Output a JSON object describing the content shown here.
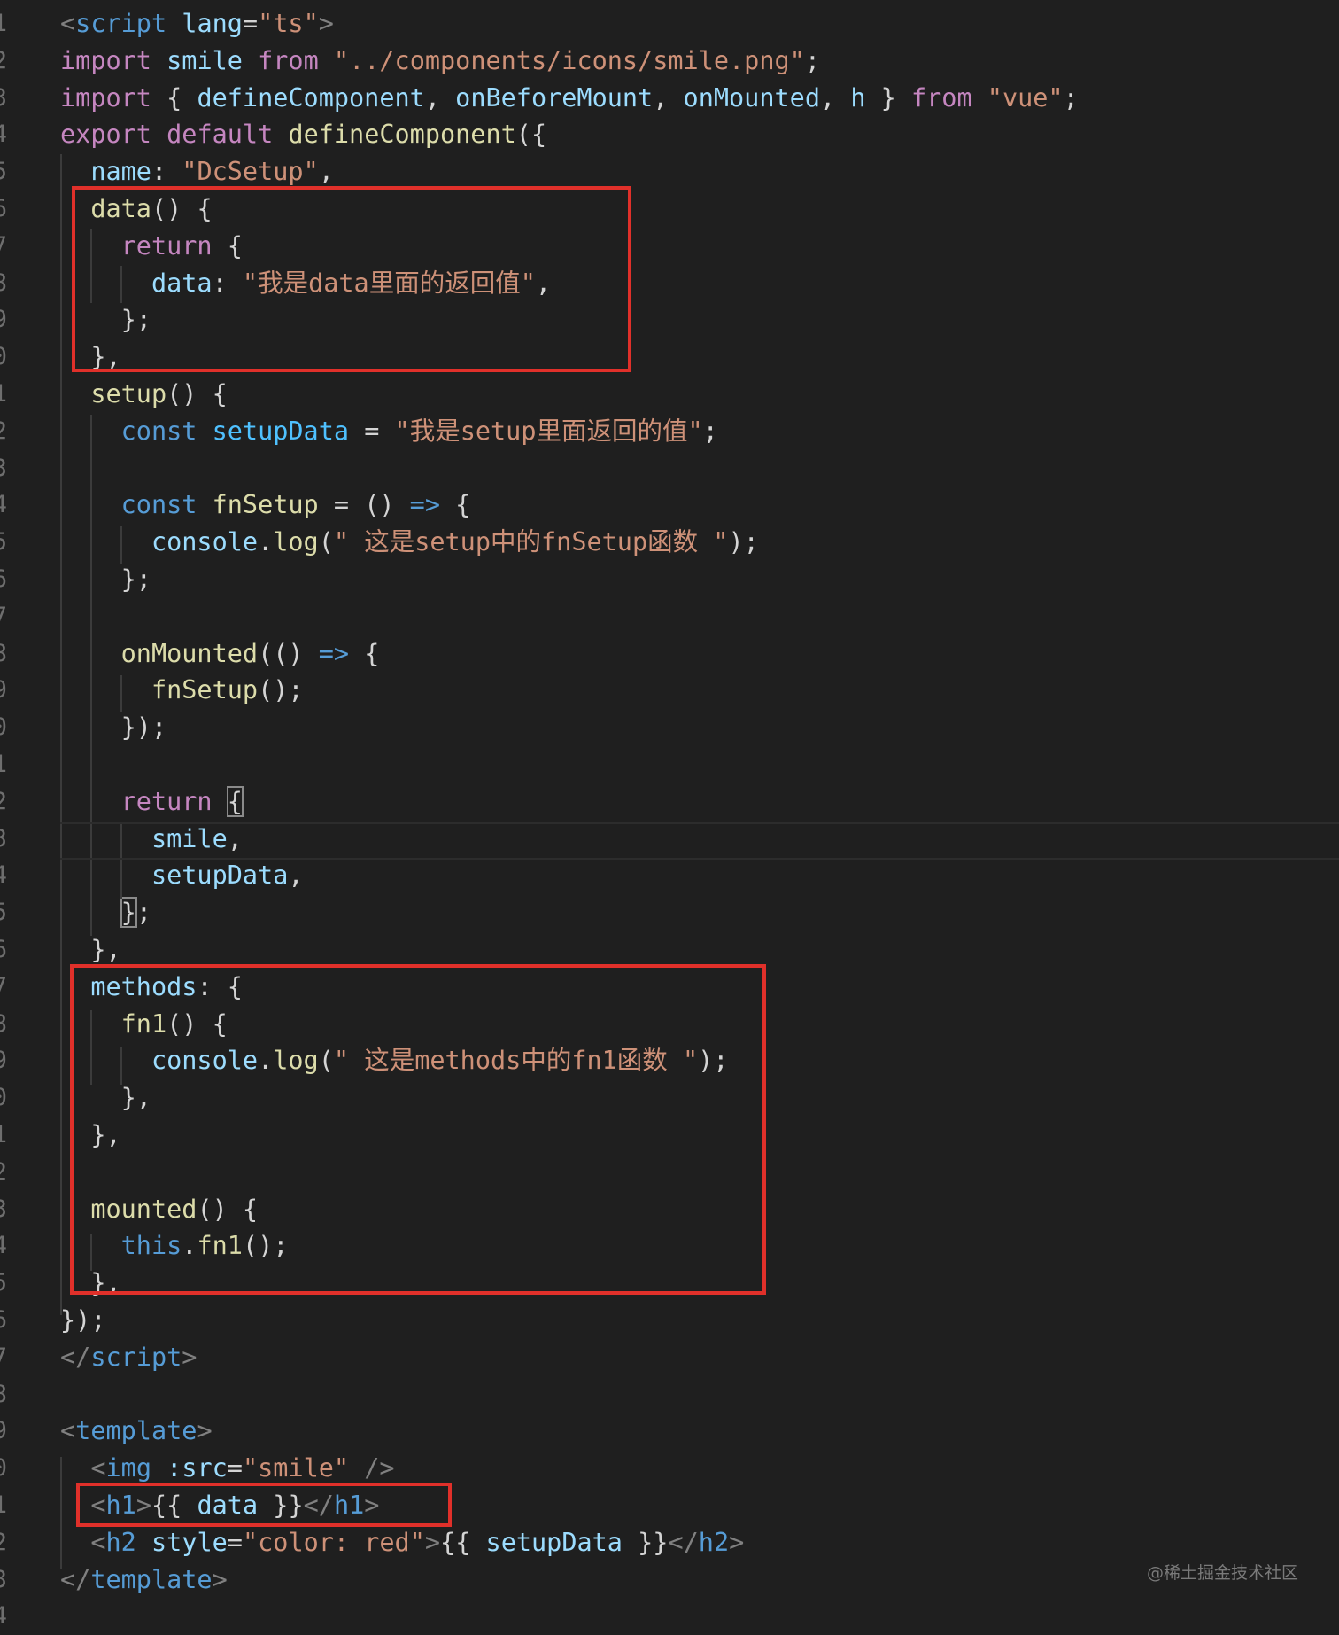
{
  "editor": {
    "line_numbers": [
      "1",
      "2",
      "3",
      "4",
      "5",
      "6",
      "7",
      "8",
      "9",
      "0",
      "1",
      "2",
      "3",
      "4",
      "5",
      "6",
      "7",
      "8",
      "9",
      "0",
      "1",
      "2",
      "3",
      "4",
      "5",
      "6",
      "7",
      "8",
      "9",
      "0",
      "1",
      "2",
      "3",
      "4",
      "5",
      "6",
      "7",
      "8",
      "9",
      "0",
      "1",
      "2",
      "3",
      "4"
    ],
    "lines": [
      [
        [
          "brk",
          "<"
        ],
        [
          "tag",
          "script"
        ],
        [
          "attr",
          " lang"
        ],
        [
          "pun",
          "="
        ],
        [
          "str",
          "\"ts\""
        ],
        [
          "brk",
          ">"
        ]
      ],
      [
        [
          "kw",
          "import"
        ],
        [
          "pun",
          " "
        ],
        [
          "var",
          "smile"
        ],
        [
          "pun",
          " "
        ],
        [
          "kw",
          "from"
        ],
        [
          "pun",
          " "
        ],
        [
          "str",
          "\"../components/icons/smile.png\""
        ],
        [
          "pun",
          ";"
        ]
      ],
      [
        [
          "kw",
          "import"
        ],
        [
          "pun",
          " { "
        ],
        [
          "var",
          "defineComponent"
        ],
        [
          "pun",
          ", "
        ],
        [
          "var",
          "onBeforeMount"
        ],
        [
          "pun",
          ", "
        ],
        [
          "var",
          "onMounted"
        ],
        [
          "pun",
          ", "
        ],
        [
          "var",
          "h"
        ],
        [
          "pun",
          " } "
        ],
        [
          "kw",
          "from"
        ],
        [
          "pun",
          " "
        ],
        [
          "str",
          "\"vue\""
        ],
        [
          "pun",
          ";"
        ]
      ],
      [
        [
          "kw",
          "export"
        ],
        [
          "pun",
          " "
        ],
        [
          "kw",
          "default"
        ],
        [
          "pun",
          " "
        ],
        [
          "fn",
          "defineComponent"
        ],
        [
          "pun",
          "({"
        ]
      ],
      [
        [
          "pun",
          "  "
        ],
        [
          "var",
          "name"
        ],
        [
          "pun",
          ": "
        ],
        [
          "str",
          "\"DcSetup\""
        ],
        [
          "pun",
          ","
        ]
      ],
      [
        [
          "pun",
          "  "
        ],
        [
          "fn",
          "data"
        ],
        [
          "pun",
          "() {"
        ]
      ],
      [
        [
          "pun",
          "    "
        ],
        [
          "kw",
          "return"
        ],
        [
          "pun",
          " {"
        ]
      ],
      [
        [
          "pun",
          "      "
        ],
        [
          "var",
          "data"
        ],
        [
          "pun",
          ": "
        ],
        [
          "str",
          "\"我是data里面的返回值\""
        ],
        [
          "pun",
          ","
        ]
      ],
      [
        [
          "pun",
          "    };"
        ]
      ],
      [
        [
          "pun",
          "  },"
        ]
      ],
      [
        [
          "pun",
          "  "
        ],
        [
          "fn",
          "setup"
        ],
        [
          "pun",
          "() {"
        ]
      ],
      [
        [
          "pun",
          "    "
        ],
        [
          "kwb",
          "const"
        ],
        [
          "pun",
          " "
        ],
        [
          "cst",
          "setupData"
        ],
        [
          "pun",
          " = "
        ],
        [
          "str",
          "\"我是setup里面返回的值\""
        ],
        [
          "pun",
          ";"
        ]
      ],
      [],
      [
        [
          "pun",
          "    "
        ],
        [
          "kwb",
          "const"
        ],
        [
          "pun",
          " "
        ],
        [
          "fn",
          "fnSetup"
        ],
        [
          "pun",
          " = () "
        ],
        [
          "kwb",
          "=>"
        ],
        [
          "pun",
          " {"
        ]
      ],
      [
        [
          "pun",
          "      "
        ],
        [
          "var",
          "console"
        ],
        [
          "pun",
          "."
        ],
        [
          "fn",
          "log"
        ],
        [
          "pun",
          "("
        ],
        [
          "str",
          "\" 这是setup中的fnSetup函数 \""
        ],
        [
          "pun",
          ");"
        ]
      ],
      [
        [
          "pun",
          "    };"
        ]
      ],
      [],
      [
        [
          "pun",
          "    "
        ],
        [
          "fn",
          "onMounted"
        ],
        [
          "pun",
          "(() "
        ],
        [
          "kwb",
          "=>"
        ],
        [
          "pun",
          " {"
        ]
      ],
      [
        [
          "pun",
          "      "
        ],
        [
          "fn",
          "fnSetup"
        ],
        [
          "pun",
          "();"
        ]
      ],
      [
        [
          "pun",
          "    });"
        ]
      ],
      [],
      [
        [
          "pun",
          "    "
        ],
        [
          "kw",
          "return"
        ],
        [
          "pun",
          " "
        ],
        [
          "pun",
          "{"
        ]
      ],
      [
        [
          "pun",
          "      "
        ],
        [
          "var",
          "smile"
        ],
        [
          "pun",
          ","
        ]
      ],
      [
        [
          "pun",
          "      "
        ],
        [
          "var",
          "setupData"
        ],
        [
          "pun",
          ","
        ]
      ],
      [
        [
          "pun",
          "    "
        ],
        [
          "pun",
          "}"
        ],
        [
          "pun",
          ";"
        ]
      ],
      [
        [
          "pun",
          "  },"
        ]
      ],
      [
        [
          "pun",
          "  "
        ],
        [
          "var",
          "methods"
        ],
        [
          "pun",
          ": {"
        ]
      ],
      [
        [
          "pun",
          "    "
        ],
        [
          "fn",
          "fn1"
        ],
        [
          "pun",
          "() {"
        ]
      ],
      [
        [
          "pun",
          "      "
        ],
        [
          "var",
          "console"
        ],
        [
          "pun",
          "."
        ],
        [
          "fn",
          "log"
        ],
        [
          "pun",
          "("
        ],
        [
          "str",
          "\" 这是methods中的fn1函数 \""
        ],
        [
          "pun",
          ");"
        ]
      ],
      [
        [
          "pun",
          "    },"
        ]
      ],
      [
        [
          "pun",
          "  },"
        ]
      ],
      [],
      [
        [
          "pun",
          "  "
        ],
        [
          "fn",
          "mounted"
        ],
        [
          "pun",
          "() {"
        ]
      ],
      [
        [
          "pun",
          "    "
        ],
        [
          "kwb",
          "this"
        ],
        [
          "pun",
          "."
        ],
        [
          "fn",
          "fn1"
        ],
        [
          "pun",
          "();"
        ]
      ],
      [
        [
          "pun",
          "  },"
        ]
      ],
      [
        [
          "pun",
          "});"
        ]
      ],
      [
        [
          "brk",
          "</"
        ],
        [
          "tag",
          "script"
        ],
        [
          "brk",
          ">"
        ]
      ],
      [],
      [
        [
          "brk",
          "<"
        ],
        [
          "tag",
          "template"
        ],
        [
          "brk",
          ">"
        ]
      ],
      [
        [
          "pun",
          "  "
        ],
        [
          "brk",
          "<"
        ],
        [
          "tag",
          "img"
        ],
        [
          "pun",
          " "
        ],
        [
          "attr",
          ":src"
        ],
        [
          "pun",
          "="
        ],
        [
          "str",
          "\"smile\""
        ],
        [
          "pun",
          " "
        ],
        [
          "brk",
          "/>"
        ]
      ],
      [
        [
          "pun",
          "  "
        ],
        [
          "brk",
          "<"
        ],
        [
          "tag",
          "h1"
        ],
        [
          "brk",
          ">"
        ],
        [
          "pun",
          "{{ "
        ],
        [
          "var",
          "data"
        ],
        [
          "pun",
          " }}"
        ],
        [
          "brk",
          "</"
        ],
        [
          "tag",
          "h1"
        ],
        [
          "brk",
          ">"
        ]
      ],
      [
        [
          "pun",
          "  "
        ],
        [
          "brk",
          "<"
        ],
        [
          "tag",
          "h2"
        ],
        [
          "pun",
          " "
        ],
        [
          "attr",
          "style"
        ],
        [
          "pun",
          "="
        ],
        [
          "str",
          "\"color: red\""
        ],
        [
          "brk",
          ">"
        ],
        [
          "pun",
          "{{ "
        ],
        [
          "var",
          "setupData"
        ],
        [
          "pun",
          " }}"
        ],
        [
          "brk",
          "</"
        ],
        [
          "tag",
          "h2"
        ],
        [
          "brk",
          ">"
        ]
      ],
      [
        [
          "brk",
          "</"
        ],
        [
          "tag",
          "template"
        ],
        [
          "brk",
          ">"
        ]
      ]
    ]
  },
  "watermark": "@稀土掘金技术社区",
  "colors": {
    "background": "#1f1f1f",
    "highlight_box": "#e0302a"
  }
}
